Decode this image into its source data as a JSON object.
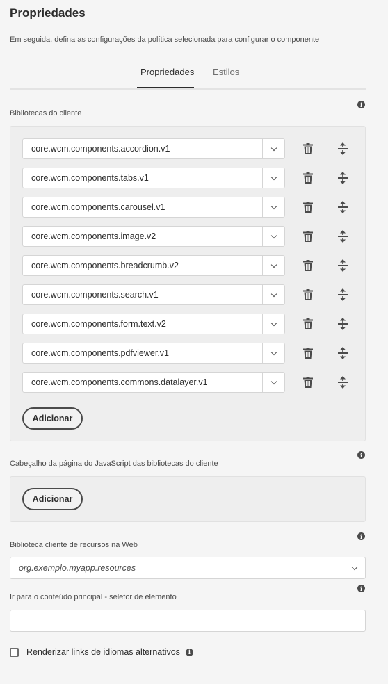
{
  "header": {
    "title": "Propriedades",
    "subtitle": "Em seguida, defina as configurações da política selecionada para configurar o componente"
  },
  "tabs": [
    {
      "label": "Propriedades",
      "active": true
    },
    {
      "label": "Estilos",
      "active": false
    }
  ],
  "client_libraries": {
    "label": "Bibliotecas do cliente",
    "items": [
      "core.wcm.components.accordion.v1",
      "core.wcm.components.tabs.v1",
      "core.wcm.components.carousel.v1",
      "core.wcm.components.image.v2",
      "core.wcm.components.breadcrumb.v2",
      "core.wcm.components.search.v1",
      "core.wcm.components.form.text.v2",
      "core.wcm.components.pdfviewer.v1",
      "core.wcm.components.commons.datalayer.v1"
    ],
    "add_label": "Adicionar"
  },
  "js_head_libraries": {
    "label": "Cabeçalho da página do JavaScript das bibliotecas do cliente",
    "add_label": "Adicionar"
  },
  "web_resources": {
    "label": "Biblioteca cliente de recursos na Web",
    "value": "org.exemplo.myapp.resources"
  },
  "main_content_selector": {
    "label": "Ir para o conteúdo principal - seletor de elemento",
    "value": ""
  },
  "alt_language_links": {
    "label": "Renderizar links de idiomas alternativos",
    "checked": false
  },
  "icons": {
    "info": "info-icon",
    "delete": "trash-icon",
    "reorder": "move-icon",
    "dropdown": "chevron-down-icon"
  },
  "colors": {
    "background": "#f5f5f5",
    "text": "#2c2c2c",
    "panel": "#eeeeee"
  }
}
